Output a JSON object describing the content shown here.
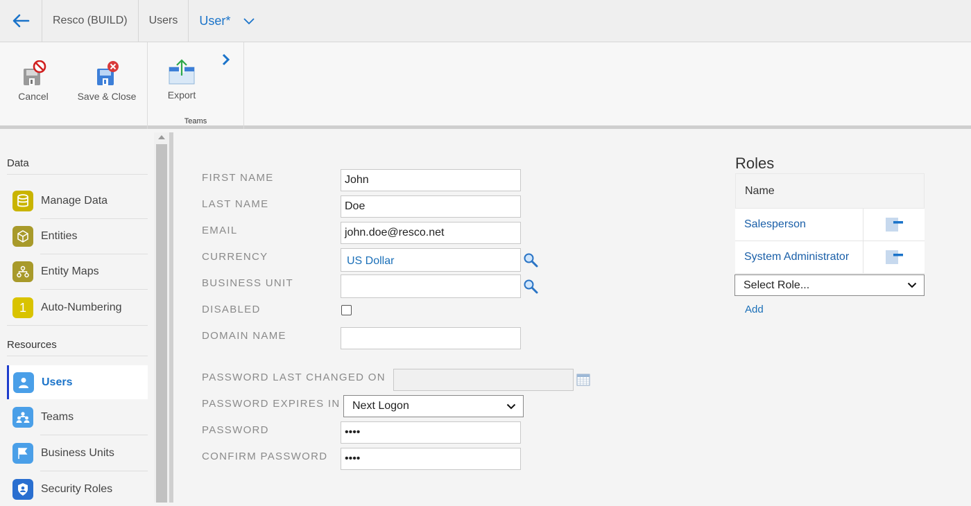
{
  "breadcrumbs": [
    "Resco (BUILD)",
    "Users",
    "User*"
  ],
  "ribbon": {
    "cancel": "Cancel",
    "save_close": "Save & Close",
    "export": "Export",
    "group_label": "Teams"
  },
  "sidebar": {
    "section_data": "Data",
    "data_items": [
      "Manage Data",
      "Entities",
      "Entity Maps",
      "Auto-Numbering"
    ],
    "section_resources": "Resources",
    "resource_items": [
      "Users",
      "Teams",
      "Business Units",
      "Security Roles"
    ],
    "autonumber_glyph": "1"
  },
  "form": {
    "first_name_label": "FIRST NAME",
    "first_name": "John",
    "last_name_label": "LAST NAME",
    "last_name": "Doe",
    "email_label": "EMAIL",
    "email": "john.doe@resco.net",
    "currency_label": "CURRENCY",
    "currency": "US Dollar",
    "business_unit_label": "BUSINESS UNIT",
    "business_unit": "",
    "disabled_label": "DISABLED",
    "domain_name_label": "DOMAIN NAME",
    "domain_name": "",
    "pwd_changed_label": "PASSWORD LAST CHANGED ON",
    "pwd_changed": "",
    "pwd_expires_label": "PASSWORD EXPIRES IN",
    "pwd_expires": "Next Logon",
    "password_label": "PASSWORD",
    "password": "••••",
    "confirm_password_label": "CONFIRM PASSWORD",
    "confirm_password": "••••"
  },
  "roles": {
    "title": "Roles",
    "column_name": "Name",
    "items": [
      "Salesperson",
      "System Administrator"
    ],
    "select_placeholder": "Select Role...",
    "add_label": "Add"
  },
  "colors": {
    "accent": "#1a73c9",
    "data_icon": "#c9b400",
    "resource_icon": "#4a9fe8",
    "selected_marker": "#1d3ccc"
  }
}
